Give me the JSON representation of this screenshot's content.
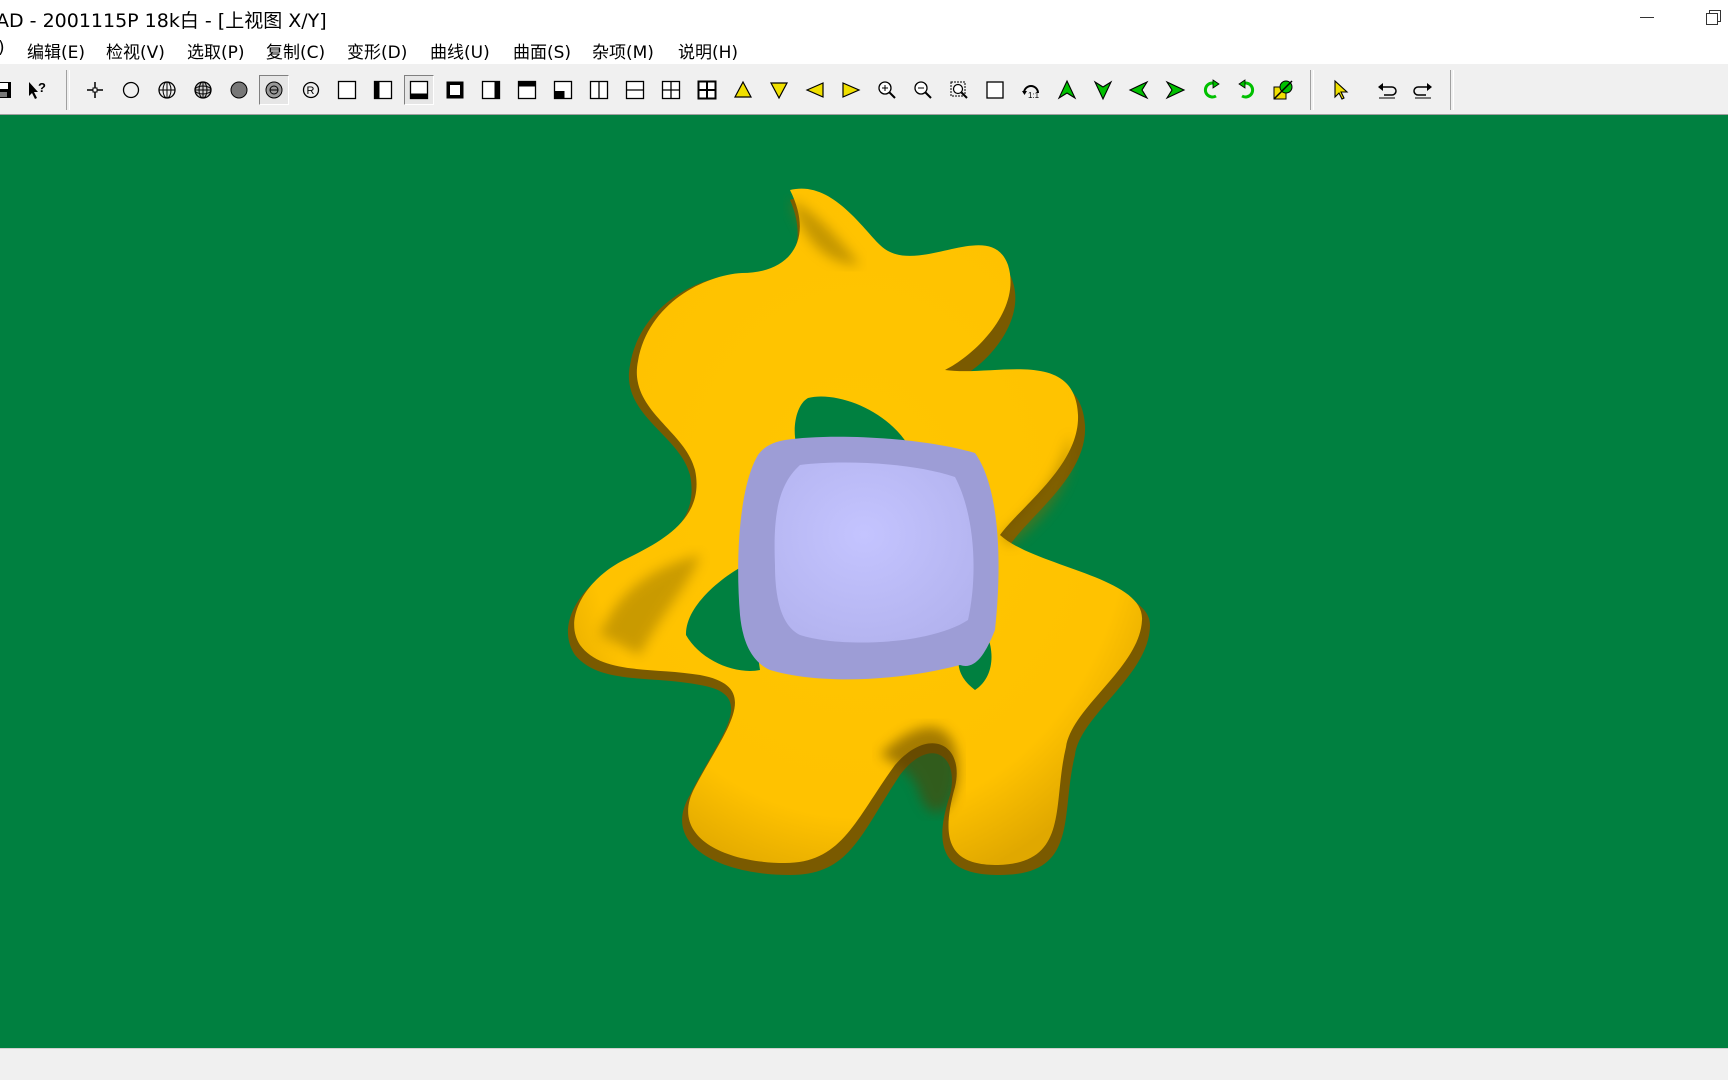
{
  "window": {
    "title": "AD - 2001115P 18k白 - [上视图 X/Y]"
  },
  "menu": {
    "items": [
      {
        "label": ")"
      },
      {
        "label": "编辑(E)"
      },
      {
        "label": "检视(V)"
      },
      {
        "label": "选取(P)"
      },
      {
        "label": "复制(C)"
      },
      {
        "label": "变形(D)"
      },
      {
        "label": "曲线(U)"
      },
      {
        "label": "曲面(S)"
      },
      {
        "label": "杂项(M)"
      },
      {
        "label": "说明(H)"
      }
    ]
  },
  "toolbar": {
    "icons": [
      "save-icon",
      "help-cursor-icon",
      "point-icon",
      "circle-icon",
      "sphere-wire-icon",
      "sphere-grid-icon",
      "shaded-sphere-icon",
      "rendered-sphere-icon",
      "refresh-sphere-icon",
      "view-single-icon",
      "view-left-icon",
      "view-bottom-icon",
      "view-frame-icon",
      "view-right-icon",
      "view-top-icon",
      "view-bottom-left-icon",
      "view-split-vertical-icon",
      "view-split-horizontal-icon",
      "view-quad-icon",
      "view-quad-bold-icon",
      "pan-up-icon",
      "pan-down-icon",
      "pan-left-icon",
      "pan-right-icon",
      "zoom-in-icon",
      "zoom-out-icon",
      "zoom-window-icon",
      "zoom-all-icon",
      "zoom-previous-icon",
      "rotate-up-icon",
      "rotate-down-icon",
      "rotate-left-icon",
      "rotate-right-icon",
      "rotate-ccw-icon",
      "rotate-cw-icon",
      "render-view-icon",
      "select-arrow-icon",
      "undo-icon",
      "redo-icon"
    ],
    "pressed": [
      "rendered-sphere-icon",
      "view-bottom-icon"
    ],
    "colors": {
      "yellow": "#f0e000",
      "green": "#00c000",
      "black": "#000000"
    }
  },
  "viewport": {
    "background": "#008040",
    "ring_color": "#ffc400",
    "ring_shadow": "#8a6a00",
    "gem_outer": "#9f9fd8",
    "gem_inner": "#bcbcf8"
  }
}
